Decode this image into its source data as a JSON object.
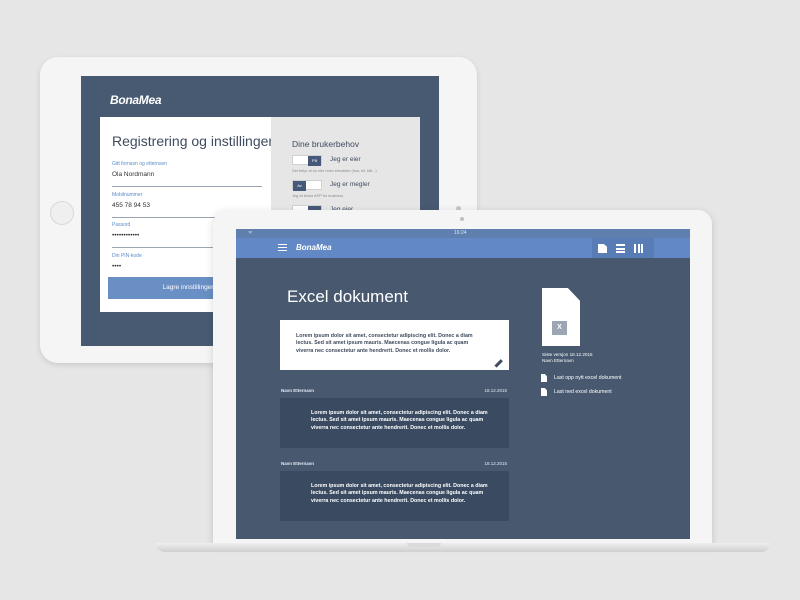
{
  "tablet": {
    "logo": "BonaMea",
    "registration": {
      "title": "Registrering og instillinger",
      "fields": [
        {
          "label": "Gitt fornavn og etternavn",
          "value": "Ola Nordmann"
        },
        {
          "label": "Mobilnummer",
          "value": "455 78 94 53"
        },
        {
          "label": "Passord",
          "value": "••••••••••••"
        },
        {
          "label": "Din PIN-kode",
          "value": "••••"
        }
      ],
      "save_label": "Lagre innstillinger"
    },
    "needs": {
      "title": "Dine brukerbehov",
      "items": [
        {
          "toggle": "På",
          "label": "Jeg er eier",
          "desc": "Det betyr at du eier noen eiendeler (hus, bil, båt...)",
          "on": true
        },
        {
          "toggle": "Av",
          "label": "Jeg er megler",
          "desc": "Jeg vil bruke APP for business",
          "on": false
        },
        {
          "toggle": "",
          "label": "Jeg eier",
          "desc": "",
          "on": true
        }
      ]
    }
  },
  "laptop": {
    "status": {
      "wifi": "ᯤ",
      "time": "16:24"
    },
    "logo": "BonaMea",
    "doc_title": "Excel dokument",
    "lorem_main": "Lorem ipsum dolor sit amet, consectetur adipiscing elit. Donec a diam lectus. Sed sit amet ipsum mauris. Maecenas congue ligula ac quam viverra nec consectetur ante hendrerit. Donec et mollis dolor.",
    "comments": [
      {
        "author": "Navn Etternavn",
        "date": "18.12.2015",
        "text": "Lorem ipsum dolor sit amet, consectetur adipiscing elit. Donec a diam lectus. Sed sit amet ipsum mauris. Maecenas congue ligula ac quam viverra nec consectetur ante hendrerit. Donec et mollis dolor."
      },
      {
        "author": "Navn Etternavn",
        "date": "18.12.2015",
        "text": "Lorem ipsum dolor sit amet, consectetur adipiscing elit. Donec a diam lectus. Sed sit amet ipsum mauris. Maecenas congue ligula ac quam viverra nec consectetur ante hendrerit. Donec et mollis dolor."
      }
    ],
    "file": {
      "badge": "X",
      "version": "Siste versjon 18.12.2015",
      "author": "Navn Etternavn"
    },
    "actions": [
      {
        "label": "Last opp nytt excel dokument"
      },
      {
        "label": "Last ned excel dokument"
      }
    ]
  }
}
